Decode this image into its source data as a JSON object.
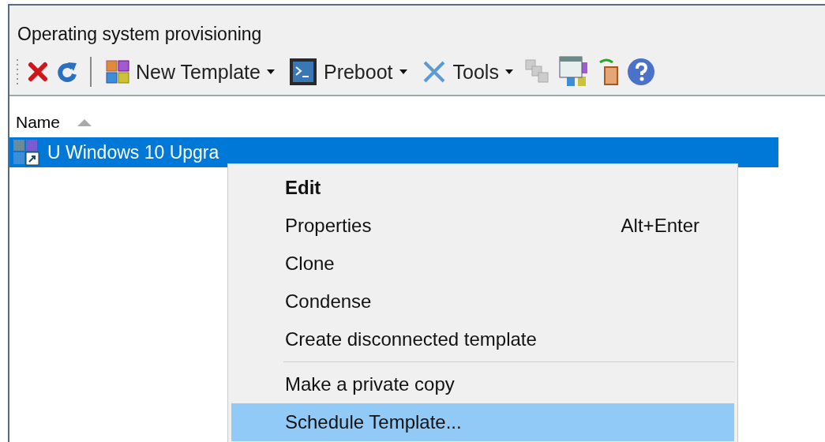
{
  "panel": {
    "title": "Operating system provisioning"
  },
  "toolbar": [
    {
      "kind": "dropdown",
      "label": "New Template"
    },
    {
      "kind": "dropdown",
      "label": "Preboot"
    },
    {
      "kind": "dropdown",
      "label": "Tools"
    }
  ],
  "list": {
    "columns": [
      {
        "label": "Name",
        "sorted": true
      }
    ],
    "rows": [
      {
        "name": "U Windows 10 Upgra",
        "selected": true
      }
    ]
  },
  "context_menu": [
    {
      "kind": "item",
      "label": "Edit",
      "default": true,
      "selected": false
    },
    {
      "kind": "item",
      "label": "Properties",
      "shortcut": "Alt+Enter",
      "default": false,
      "selected": false
    },
    {
      "kind": "item",
      "label": "Clone",
      "default": false,
      "selected": false
    },
    {
      "kind": "item",
      "label": "Condense",
      "default": false,
      "selected": false
    },
    {
      "kind": "item",
      "label": "Create disconnected template",
      "default": false,
      "selected": false
    },
    {
      "kind": "separator"
    },
    {
      "kind": "item",
      "label": "Make a private copy",
      "default": false,
      "selected": false
    },
    {
      "kind": "item",
      "label": "Schedule Template...",
      "default": false,
      "selected": true
    }
  ]
}
